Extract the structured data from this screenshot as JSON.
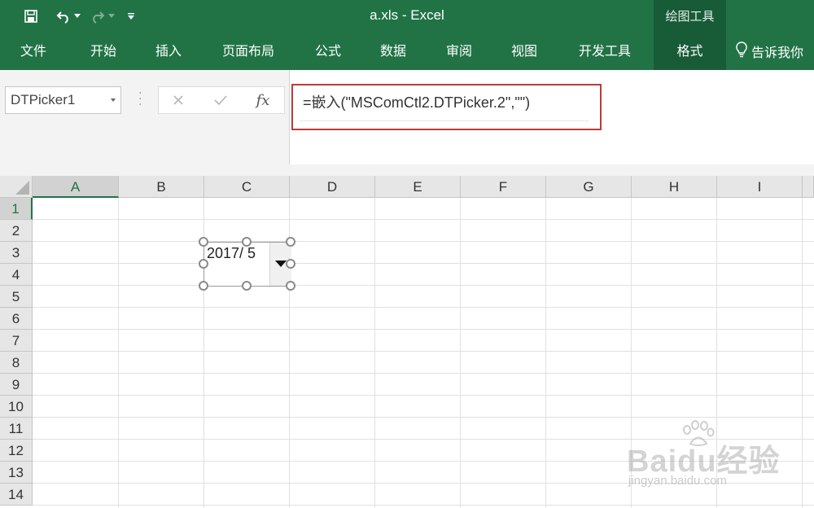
{
  "window": {
    "title": "a.xls  -  Excel",
    "context_group": "绘图工具"
  },
  "ribbon": {
    "tabs": [
      "文件",
      "开始",
      "插入",
      "页面布局",
      "公式",
      "数据",
      "审阅",
      "视图",
      "开发工具",
      "格式"
    ],
    "active_tab": "格式",
    "tell_me": "告诉我你"
  },
  "formula_bar": {
    "name_box": "DTPicker1",
    "fx_label": "fx",
    "formula": "=嵌入(\"MSComCtl2.DTPicker.2\",\"\")"
  },
  "sheet": {
    "columns": [
      "A",
      "B",
      "C",
      "D",
      "E",
      "F",
      "G",
      "H",
      "I"
    ],
    "rows": [
      "1",
      "2",
      "3",
      "4",
      "5",
      "6",
      "7",
      "8",
      "9",
      "10",
      "11",
      "12",
      "13",
      "14"
    ],
    "selected_column": "A",
    "selected_row": "1"
  },
  "dtpicker": {
    "value": "2017/ 5"
  },
  "watermark": {
    "logo": "Baidu经验",
    "url": "jingyan.baidu.com"
  },
  "colors": {
    "excel_green": "#217346",
    "active_tab": "#185c37",
    "highlight_red": "#c0393b"
  }
}
